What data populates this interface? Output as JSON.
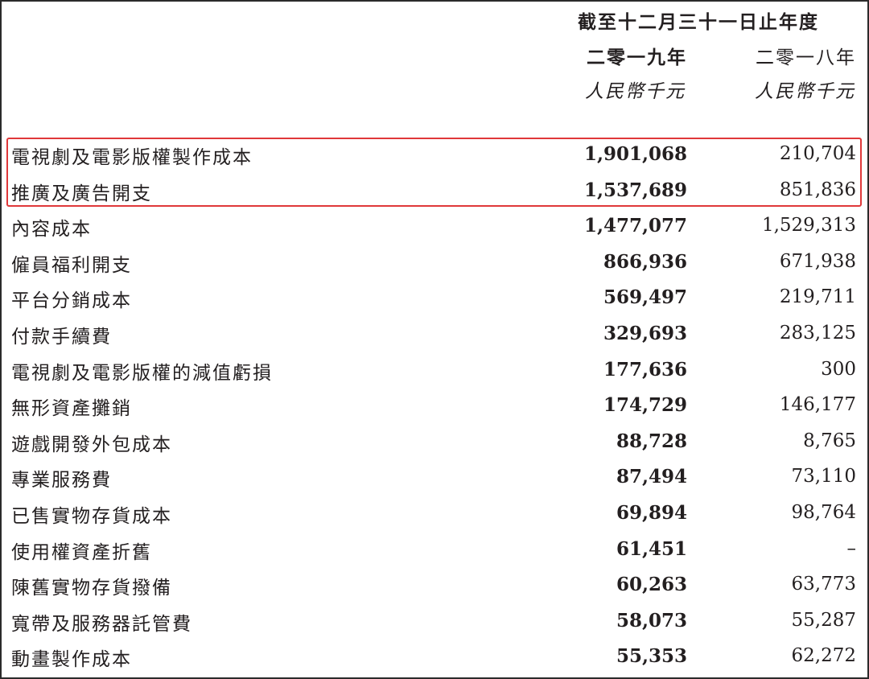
{
  "header": {
    "period": "截至十二月三十一日止年度",
    "year_2019": "二零一九年",
    "year_2018": "二零一八年",
    "currency_2019": "人民幣千元",
    "currency_2018": "人民幣千元"
  },
  "highlight_color": "#e0383a",
  "rows": [
    {
      "label": "電視劇及電影版權製作成本",
      "v2019": "1,901,068",
      "v2018": "210,704"
    },
    {
      "label": "推廣及廣告開支",
      "v2019": "1,537,689",
      "v2018": "851,836"
    },
    {
      "label": "內容成本",
      "v2019": "1,477,077",
      "v2018": "1,529,313"
    },
    {
      "label": "僱員福利開支",
      "v2019": "866,936",
      "v2018": "671,938"
    },
    {
      "label": "平台分銷成本",
      "v2019": "569,497",
      "v2018": "219,711"
    },
    {
      "label": "付款手續費",
      "v2019": "329,693",
      "v2018": "283,125"
    },
    {
      "label": "電視劇及電影版權的減值虧損",
      "v2019": "177,636",
      "v2018": "300"
    },
    {
      "label": "無形資產攤銷",
      "v2019": "174,729",
      "v2018": "146,177"
    },
    {
      "label": "遊戲開發外包成本",
      "v2019": "88,728",
      "v2018": "8,765"
    },
    {
      "label": "專業服務費",
      "v2019": "87,494",
      "v2018": "73,110"
    },
    {
      "label": "已售實物存貨成本",
      "v2019": "69,894",
      "v2018": "98,764"
    },
    {
      "label": "使用權資產折舊",
      "v2019": "61,451",
      "v2018": "–"
    },
    {
      "label": "陳舊實物存貨撥備",
      "v2019": "60,263",
      "v2018": "63,773"
    },
    {
      "label": "寬帶及服務器託管費",
      "v2019": "58,073",
      "v2018": "55,287"
    },
    {
      "label": "動畫製作成本",
      "v2019": "55,353",
      "v2018": "62,272"
    }
  ]
}
